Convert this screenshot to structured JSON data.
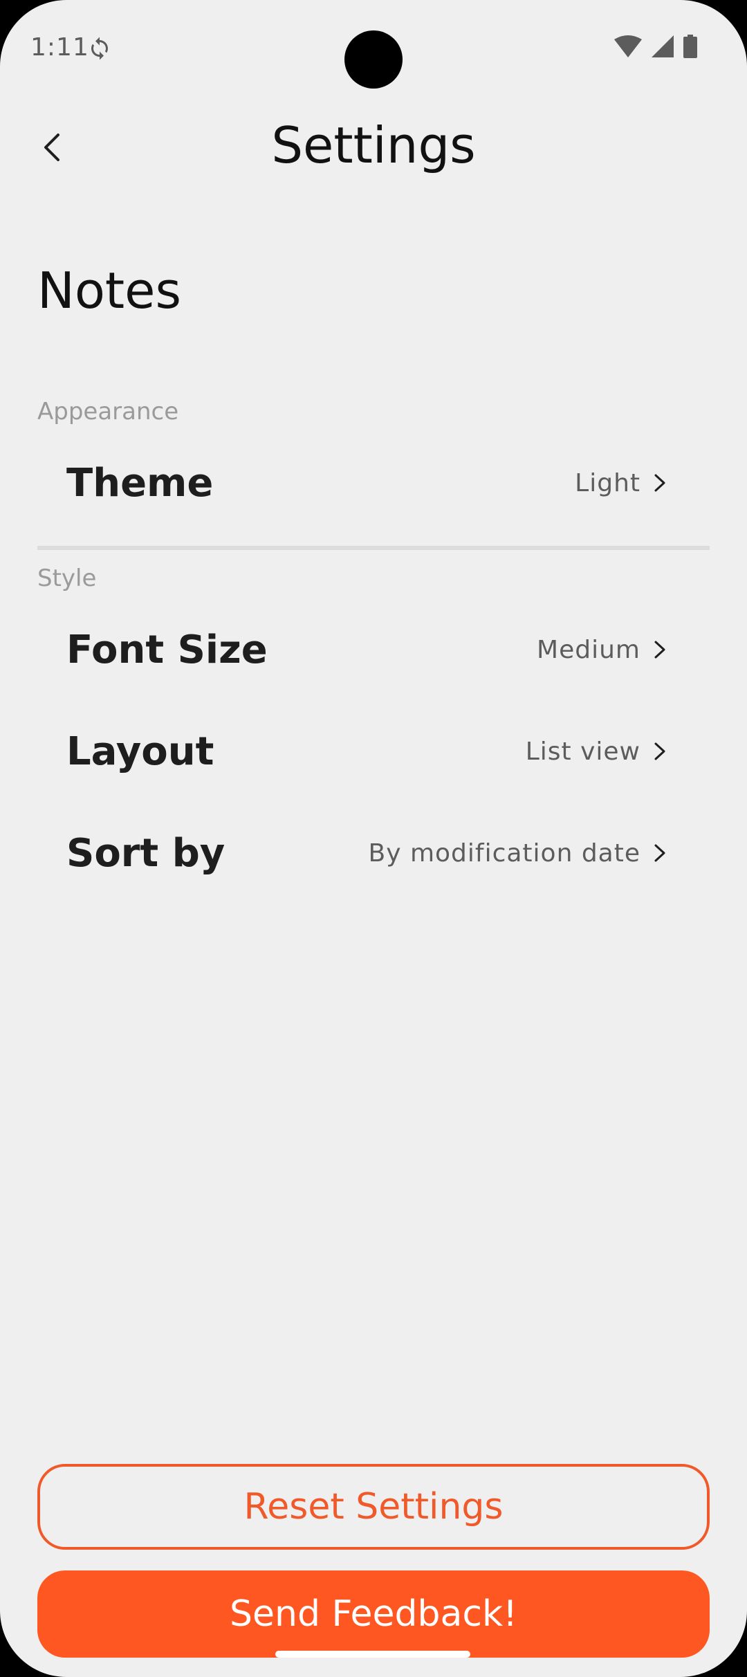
{
  "status_bar": {
    "time": "1:11",
    "icons": [
      "sync-icon",
      "wifi-icon",
      "signal-icon",
      "battery-icon"
    ]
  },
  "app_bar": {
    "back_icon": "chevron-left-icon",
    "title": "Settings"
  },
  "section": {
    "title": "Notes"
  },
  "groups": [
    {
      "label": "Appearance",
      "items": [
        {
          "label": "Theme",
          "value": "Light"
        }
      ]
    },
    {
      "label": "Style",
      "items": [
        {
          "label": "Font Size",
          "value": "Medium"
        },
        {
          "label": "Layout",
          "value": "List view"
        },
        {
          "label": "Sort by",
          "value": "By modification date"
        }
      ]
    }
  ],
  "buttons": {
    "reset_label": "Reset Settings",
    "feedback_label": "Send Feedback!"
  },
  "colors": {
    "accent": "#ff5722",
    "background": "#efefef",
    "text_primary": "#1e1e1e",
    "text_secondary": "#5c5c5c",
    "group_label": "#9a9a9a"
  }
}
